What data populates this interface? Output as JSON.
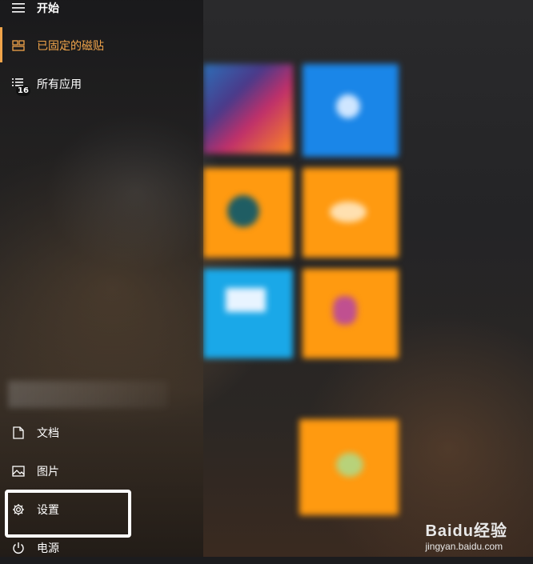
{
  "header": {
    "title": "开始"
  },
  "nav": {
    "pinned_tiles": "已固定的磁贴",
    "all_apps": "所有应用",
    "all_apps_badge": "16",
    "documents": "文档",
    "pictures": "图片",
    "settings": "设置",
    "power": "电源"
  },
  "watermark": {
    "logo": "Baidu经验",
    "url": "jingyan.baidu.com"
  },
  "colors": {
    "accent": "#f0a44a",
    "tile_orange": "#ff9a10",
    "tile_blue": "#1a86e8",
    "tile_cyan": "#1aa8e8",
    "highlight": "#ffffff"
  }
}
